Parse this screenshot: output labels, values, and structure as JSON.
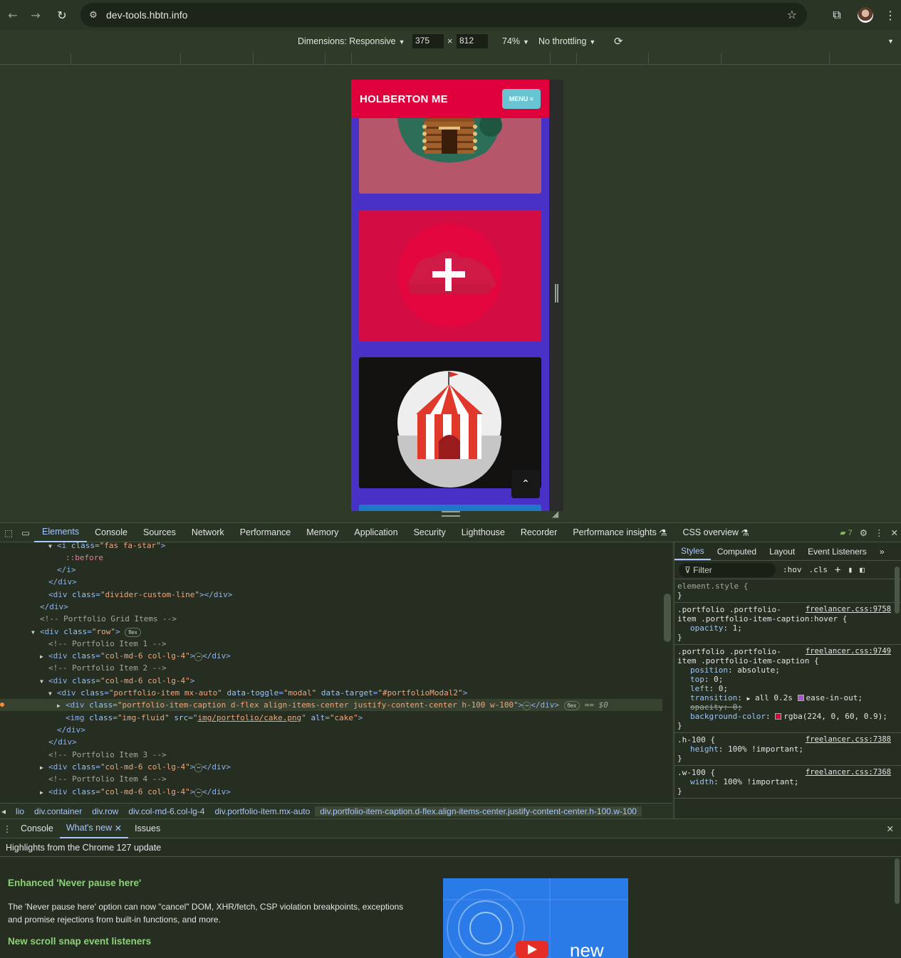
{
  "browser": {
    "url": "dev-tools.hbtn.info"
  },
  "device_toolbar": {
    "dimensions_label": "Dimensions: Responsive",
    "width": "375",
    "times": "×",
    "height": "812",
    "zoom": "74%",
    "throttling": "No throttling"
  },
  "site": {
    "brand": "HOLBERTON ME",
    "menu_label": "MENU ≡"
  },
  "devtools": {
    "tabs": [
      "Elements",
      "Console",
      "Sources",
      "Network",
      "Performance",
      "Memory",
      "Application",
      "Security",
      "Lighthouse",
      "Recorder",
      "Performance insights",
      "CSS overview"
    ],
    "issues_count": "7"
  },
  "elements": {
    "l1_class": "\"fas fa-star\"",
    "before": "::before",
    "l5_class": "\"divider-custom-line\"",
    "c_grid": "<!-- Portfolio Grid Items -->",
    "row_class": "\"row\"",
    "c_item1": "<!-- Portfolio Item 1 -->",
    "col_class": "\"col-md-6 col-lg-4\"",
    "c_item2": "<!-- Portfolio Item 2 -->",
    "pi_class": "\"portfolio-item mx-auto\"",
    "toggle": "\"modal\"",
    "target": "\"#portfolioModal2\"",
    "cap_class": "\"portfolio-item-caption d-flex align-items-center justify-content-center h-100 w-100\"",
    "eq": "== $0",
    "img_class": "\"img-fluid\"",
    "img_src": "img/portfolio/cake.png",
    "img_alt": "\"cake\"",
    "c_item3": "<!-- Portfolio Item 3 -->",
    "c_item4": "<!-- Portfolio Item 4 -->",
    "flex": "flex"
  },
  "breadcrumb": [
    "lio",
    "div.container",
    "div.row",
    "div.col-md-6.col-lg-4",
    "div.portfolio-item.mx-auto",
    "div.portfolio-item-caption.d-flex.align-items-center.justify-content-center.h-100.w-100"
  ],
  "styles": {
    "tabs": [
      "Styles",
      "Computed",
      "Layout",
      "Event Listeners"
    ],
    "filter_placeholder": "Filter",
    "hov": ":hov",
    "cls": ".cls",
    "element_style": "element.style {",
    "close": "}",
    "r1_sel1": ".portfolio .portfolio-",
    "r1_sel2": "item .portfolio-item-caption:hover {",
    "r1_src": "freelancer.css:9758",
    "r1_p1": "opacity",
    "r1_v1": "1;",
    "r2_sel1": ".portfolio .portfolio-",
    "r2_sel2": "item .portfolio-item-caption {",
    "r2_src": "freelancer.css:9749",
    "r2_p1": "position",
    "r2_v1": "absolute;",
    "r2_p2": "top",
    "r2_v2": "0;",
    "r2_p3": "left",
    "r2_v3": "0;",
    "r2_p4": "transition",
    "r2_v4a": "all 0.2s",
    "r2_v4b": "ease-in-out;",
    "r2_p5": "opacity: 0;",
    "r2_p6": "background-color",
    "r2_v6": "rgba(224, 0, 60, 0.9);",
    "bg_color": "#e0003c",
    "r3_sel": ".h-100 {",
    "r3_src": "freelancer.css:7388",
    "r3_p": "height",
    "r3_v": "100% !important;",
    "r4_sel": ".w-100 {",
    "r4_src": "freelancer.css:7368",
    "r4_p": "width",
    "r4_v": "100% !important;"
  },
  "drawer": {
    "tabs": [
      "Console",
      "What's new",
      "Issues"
    ],
    "highlights": "Highlights from the Chrome 127 update",
    "f1_title": "Enhanced 'Never pause here'",
    "f1_body": "The 'Never pause here' option can now \"cancel\" DOM, XHR/fetch, CSP violation breakpoints, exceptions and promise rejections from built-in functions, and more.",
    "f2_title": "New scroll snap event listeners",
    "promo_text": "new"
  }
}
